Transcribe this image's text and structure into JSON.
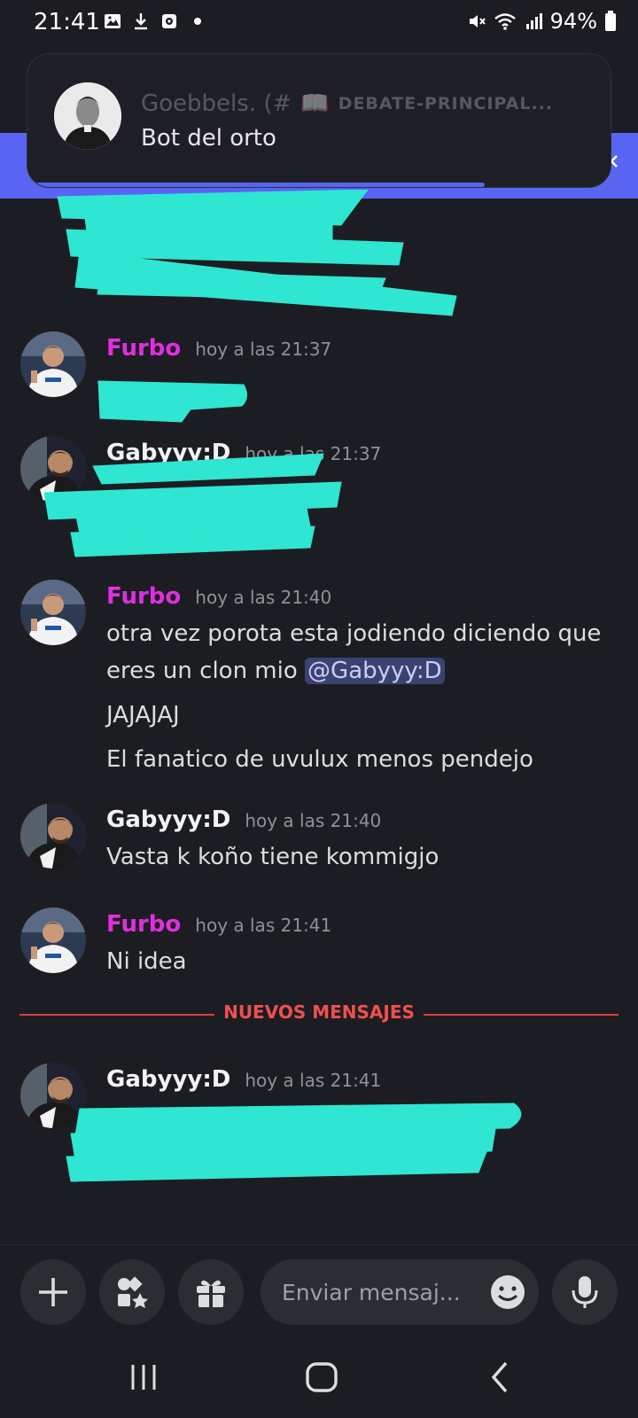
{
  "status_bar": {
    "time": "21:41",
    "battery": "94%"
  },
  "notification": {
    "author": "Goebbels. (#",
    "channel_emoji": "📖",
    "channel": "DEBATE-PRINCIPAL...",
    "message": "Bot del orto"
  },
  "messages": [
    {
      "author": "Furbo",
      "timestamp": "hoy a las 21:37"
    },
    {
      "author": "Gabyyy:D",
      "timestamp": "hoy a las 21:37"
    },
    {
      "author": "Furbo",
      "timestamp": "hoy a las 21:40",
      "line1_text": "otra vez porota esta jodiendo diciendo que eres un clon mio ",
      "mention": "@Gabyyy:D",
      "line2": "JAJAJAJ",
      "line3": "El fanatico de uvulux menos pendejo"
    },
    {
      "author": "Gabyyy:D",
      "timestamp": "hoy a las 21:40",
      "text": "Vasta k koño tiene kommigjo"
    },
    {
      "author": "Furbo",
      "timestamp": "hoy a las 21:41",
      "text": "Ni idea"
    },
    {
      "author": "Gabyyy:D",
      "timestamp": "hoy a las 21:41"
    }
  ],
  "divider": {
    "label": "NUEVOS MENSAJES"
  },
  "composer": {
    "placeholder": "Enviar mensaj..."
  },
  "colors": {
    "background": "#1c1d22",
    "blurple": "#5865f2",
    "furbo_name": "#e02fe0",
    "new_messages_red": "#e03c41",
    "redaction": "#2ee6d1",
    "mention_bg": "#3c4270"
  },
  "icons": {
    "status_left": [
      "image-icon",
      "download-icon",
      "screen-record-icon",
      "dot-icon"
    ],
    "status_right": [
      "mute-icon",
      "wifi-icon",
      "signal-icon",
      "battery-icon"
    ],
    "composer": [
      "plus-icon",
      "apps-icon",
      "gift-icon",
      "emoji-icon",
      "microphone-icon"
    ],
    "nav": [
      "recent-apps-icon",
      "home-icon",
      "back-icon"
    ]
  }
}
